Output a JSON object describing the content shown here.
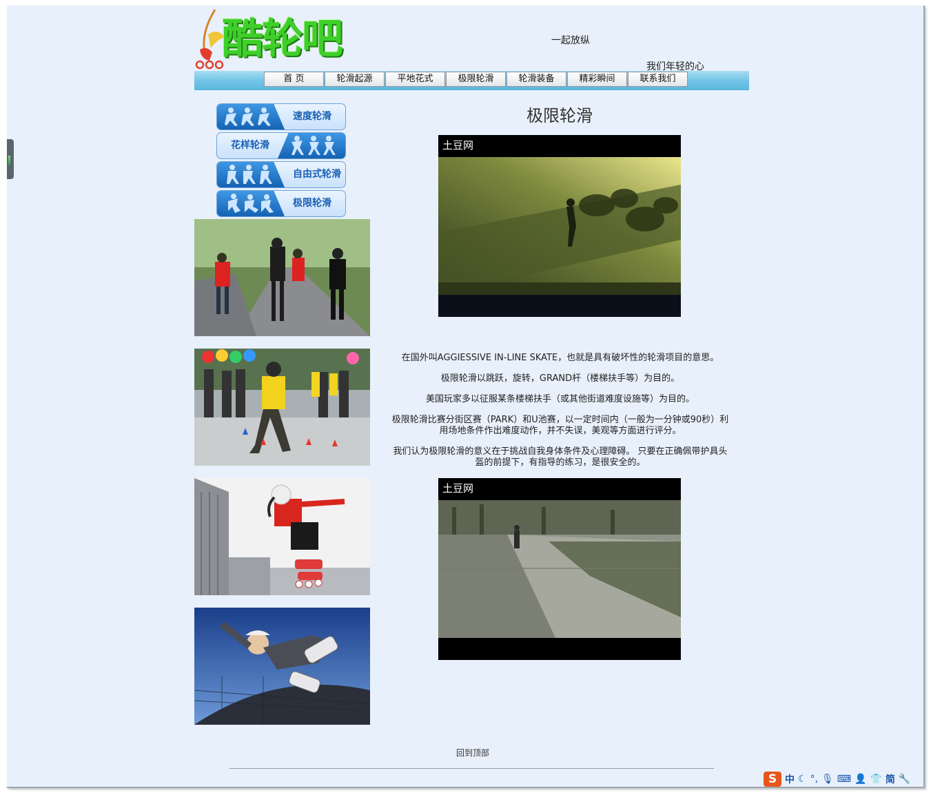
{
  "site": {
    "logo_text": "酷轮吧",
    "slogan1": "一起放纵",
    "slogan2": "我们年轻的心"
  },
  "nav": {
    "items": [
      "首 页",
      "轮滑起源",
      "平地花式",
      "极限轮滑",
      "轮滑装备",
      "精彩瞬间",
      "联系我们"
    ]
  },
  "sidebar": {
    "categories": [
      "速度轮滑",
      "花样轮滑",
      "自由式轮滑",
      "极限轮滑"
    ]
  },
  "main": {
    "title": "极限轮滑",
    "video1_brand": "土豆网",
    "video2_brand": "土豆网",
    "paragraphs": [
      "在国外叫AGGIESSIVE IN-LINE SKATE，也就是具有破坏性的轮滑项目的意思。",
      "极限轮滑以跳跃，旋转，GRAND杆（楼梯扶手等）为目的。",
      "美国玩家多以征服某条楼梯扶手（或其他街道难度设施等）为目的。",
      "极限轮滑比赛分街区赛（PARK）和U池赛，以一定时间内（一般为一分钟或90秒）利用场地条件作出难度动作，并不失误，美观等方面进行评分。",
      "我们认为极限轮滑的意义在于挑战自我身体条件及心理障碍。 只要在正确佩带护具头盔的前提下，有指导的练习，是很安全的。"
    ]
  },
  "footer": {
    "back_to_top": "回到顶部"
  },
  "ime": {
    "logo": "S",
    "chinese": "中",
    "simplified": "简"
  }
}
